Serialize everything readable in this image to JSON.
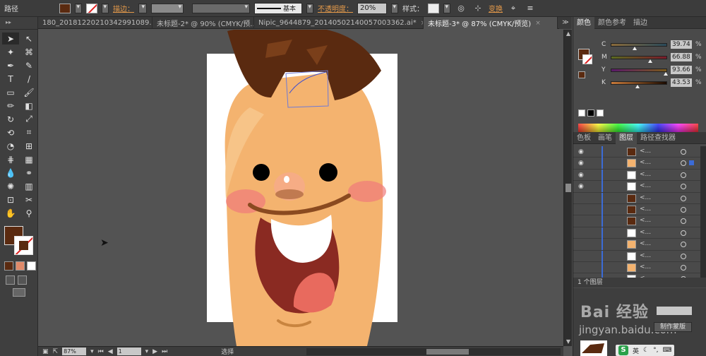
{
  "control_bar": {
    "object_type": "路径",
    "fill_color": "#5a2a10",
    "stroke_label": "描边：",
    "stroke_profile": "基本",
    "opacity_label": "不透明度：",
    "opacity_value": "20%",
    "style_label": "样式：",
    "transform_label": "变换"
  },
  "tabs": [
    {
      "label": "180_20181220210342991089.ai*",
      "active": false
    },
    {
      "label": "未标题-2* @ 90% (CMYK/预...",
      "active": false
    },
    {
      "label": "Nipic_9644879_20140502140057003362.ai*",
      "active": false
    },
    {
      "label": "未标题-3* @ 87% (CMYK/预览)",
      "active": true
    }
  ],
  "tab_close": "×",
  "tab_arrows": "≫",
  "tools": [
    "selection-tool",
    "direct-selection-tool",
    "magic-wand-tool",
    "lasso-tool",
    "pen-tool",
    "curvature-tool",
    "type-tool",
    "line-tool",
    "rectangle-tool",
    "paintbrush-tool",
    "pencil-tool",
    "eraser-tool",
    "rotate-tool",
    "scale-tool",
    "width-tool",
    "free-transform-tool",
    "shape-builder-tool",
    "perspective-grid-tool",
    "mesh-tool",
    "gradient-tool",
    "eyedropper-tool",
    "blend-tool",
    "symbol-sprayer-tool",
    "column-graph-tool",
    "artboard-tool",
    "slice-tool",
    "hand-tool",
    "zoom-tool"
  ],
  "tool_glyphs": [
    "➤",
    "↖",
    "✦",
    "⌘",
    "✒",
    "✎",
    "T",
    "/",
    "▭",
    "🖌",
    "✏",
    "◧",
    "↻",
    "⤢",
    "⟲",
    "⌗",
    "◔",
    "⊞",
    "⋕",
    "▦",
    "💧",
    "⚭",
    "✺",
    "▥",
    "⊡",
    "✂",
    "✋",
    "⚲"
  ],
  "color_panel": {
    "tabs": [
      "颜色",
      "颜色参考",
      "描边"
    ],
    "fill_color": "#5a2a10",
    "channels": [
      {
        "name": "C",
        "value": "39.74",
        "color": "#5a2a10"
      },
      {
        "name": "M",
        "value": "66.88",
        "color": "#5a2a10"
      },
      {
        "name": "Y",
        "value": "93.66",
        "color": "#5a2a10"
      },
      {
        "name": "K",
        "value": "43.53",
        "color": "#5a2a10"
      }
    ],
    "percent": "%"
  },
  "layers_panel": {
    "tabs": [
      "色板",
      "画笔",
      "图层",
      "路径查找器"
    ],
    "rows": [
      "<...",
      "<...",
      "<...",
      "<...",
      "<...",
      "<...",
      "<...",
      "<...",
      "<...",
      "<...",
      "<...",
      "<..."
    ],
    "footer": "1 个图层"
  },
  "bottom_panel": {
    "watermark_brand": "Bai 经验",
    "watermark_url": "jingyan.baidu.com",
    "make_button": "制作蒙版",
    "ime_label": "英"
  },
  "status_bar": {
    "zoom": "87%",
    "page": "1",
    "selection_label": "选择"
  }
}
